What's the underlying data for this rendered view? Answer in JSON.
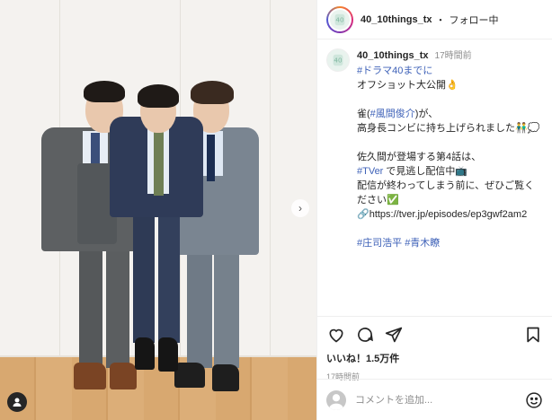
{
  "post": {
    "account": {
      "username": "40_10things_tx",
      "follow_status": "フォロー中",
      "separator": "・"
    },
    "caption": {
      "username": "40_10things_tx",
      "time_ago": "17時間前",
      "hashtag_drama": "#ドラマ40までに",
      "line_offshot": "オフショット大公開",
      "line_suzume_prefix": "雀(",
      "mention_kazama": "#風間俊介",
      "line_suzume_suffix": ")が、",
      "line_lifted": "高身長コンビに持ち上げられました",
      "line_sakuma": "佐久間が登場する第4話は、",
      "hashtag_tver": "#TVer",
      "line_tver_suffix": " で見逃し配信中",
      "line_until": "配信が終わってしまう前に、ぜひご覧く",
      "line_please": "ださい",
      "link_url": "https://tver.jp/episodes/ep3gwf2am2",
      "hashtag_shoji": "#庄司浩平",
      "hashtag_aoki": "#青木瞭"
    },
    "likes": {
      "prefix": "いいね！",
      "count": "1.5万件"
    },
    "posted_time": "17時間前",
    "comment": {
      "placeholder": "コメントを追加..."
    }
  },
  "icons": {
    "like": "heart-icon",
    "comment": "comment-bubble-icon",
    "share": "paper-plane-icon",
    "save": "bookmark-icon",
    "emoji": "smiley-icon",
    "tagged": "person-tag-icon",
    "next": "chevron-right-icon"
  },
  "colors": {
    "hashtag": "#3f62b8",
    "text": "#262626",
    "muted": "#8e8e8e"
  }
}
